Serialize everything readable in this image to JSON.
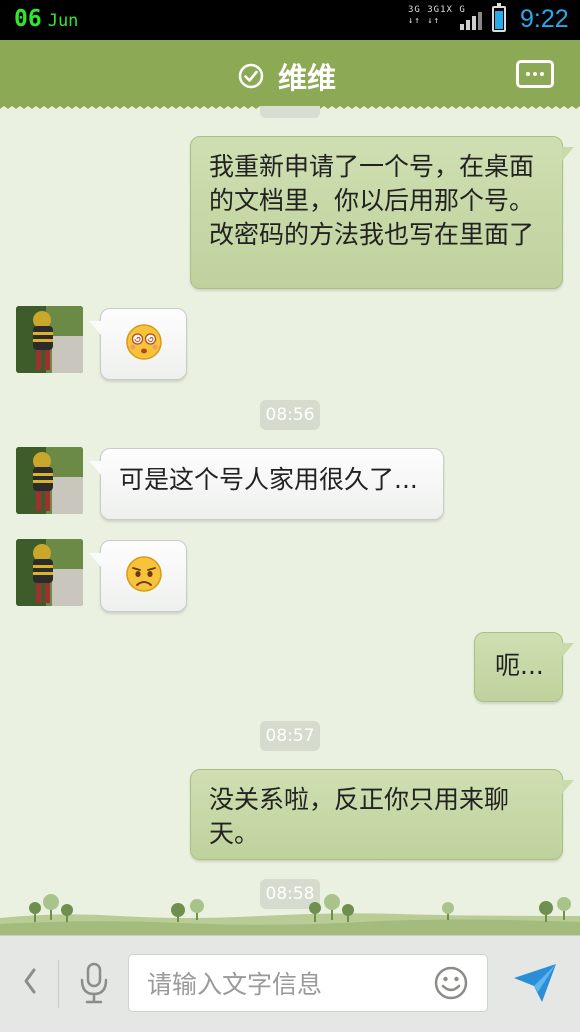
{
  "status_bar": {
    "day": "06",
    "month": "Jun",
    "network_line1": "3G 3G1X G",
    "network_line2": "↓↑ ↓↑",
    "time": "9:22",
    "icons": [
      "signal-icon",
      "battery-icon"
    ],
    "accent_color": "#29a9e9",
    "date_color": "#2ee82e"
  },
  "header": {
    "title": "维维",
    "icons": [
      "check-circle-icon",
      "more-menu-icon"
    ],
    "bg_color": "#8caa55"
  },
  "chat": {
    "messages": [
      {
        "side": "out",
        "type": "text",
        "text": "我重新申请了一个号，在桌面的文档里，你以后用那个号。改密码的方法我也写在里面了"
      },
      {
        "side": "in",
        "type": "emoji",
        "emoji": "dizzy-face-icon"
      },
      {
        "side": "time",
        "text": "08:56"
      },
      {
        "side": "in",
        "type": "text",
        "text": "可是这个号人家用很久了..."
      },
      {
        "side": "in",
        "type": "emoji",
        "emoji": "sad-face-icon"
      },
      {
        "side": "out",
        "type": "text",
        "text": "呃..."
      },
      {
        "side": "time",
        "text": "08:57"
      },
      {
        "side": "out",
        "type": "text",
        "text": "没关系啦，反正你只用来聊天。"
      },
      {
        "side": "time",
        "text": "08:58"
      }
    ],
    "bubble_out_color": "#c6d9a6",
    "background_color": "#eaf1e1"
  },
  "input_bar": {
    "placeholder": "请输入文字信息",
    "value": "",
    "icons": [
      "back-chevron-icon",
      "microphone-icon",
      "smiley-icon",
      "send-icon"
    ]
  }
}
